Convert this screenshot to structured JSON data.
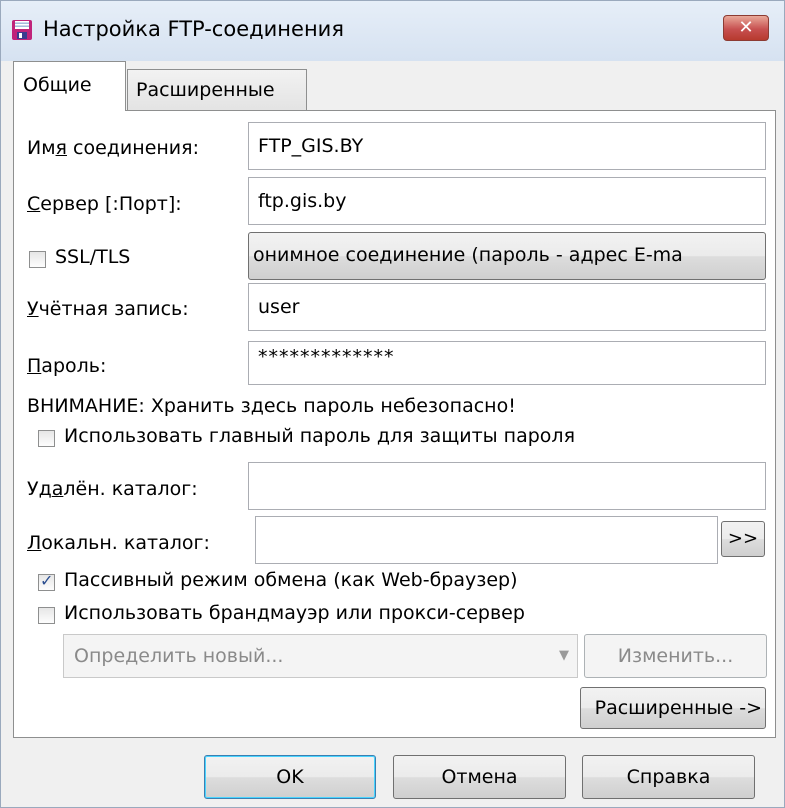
{
  "window": {
    "title": "Настройка FTP-соединения",
    "close_symbol": "✕",
    "accent_close": "#c75050"
  },
  "tabs": [
    {
      "label": "Общие",
      "active": true
    },
    {
      "label": "Расширенные",
      "active": false
    }
  ],
  "form": {
    "connection_name": {
      "label_pre": "Им",
      "label_u": "я",
      "label_post": " соединения:",
      "value": "FTP_GIS.BY"
    },
    "server": {
      "label_pre": "",
      "label_u": "С",
      "label_post": "ервер [:Порт]:",
      "value": "ftp.gis.by"
    },
    "ssl": {
      "label": "SSL/TLS",
      "checked": false
    },
    "anonymous_button": {
      "label": "онимное соединение (пароль - адрес E-ma"
    },
    "account": {
      "label_pre": "",
      "label_u": "У",
      "label_post": "чётная запись:",
      "value": "user"
    },
    "password": {
      "label_pre": "",
      "label_u": "П",
      "label_post": "ароль:",
      "value": "*************"
    },
    "warning": "ВНИМАНИЕ: Хранить здесь пароль небезопасно!",
    "master_password": {
      "label": "Использовать главный пароль для защиты пароля",
      "checked": false
    },
    "remote_dir": {
      "label_pre": "Уд",
      "label_u": "а",
      "label_post": "лён. каталог:",
      "value": ""
    },
    "local_dir": {
      "label_pre": "",
      "label_u": "Л",
      "label_post": "окальн. каталог:",
      "value": "",
      "browse": ">>"
    },
    "passive": {
      "label": "Пассивный режим обмена (как Web-браузер)",
      "checked": true
    },
    "proxy": {
      "label": "Использовать брандмауэр или прокси-сервер",
      "checked": false
    },
    "proxy_select": {
      "value": "Определить новый..."
    },
    "edit_button": "Изменить...",
    "advanced_button": "Расширенные ->"
  },
  "buttons": {
    "ok": "OK",
    "cancel": "Отмена",
    "help": "Справка"
  }
}
